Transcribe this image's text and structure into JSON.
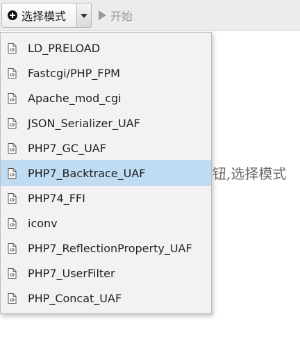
{
  "toolbar": {
    "mode_label": "选择模式",
    "start_label": "开始"
  },
  "background_text": "钮,选择模式",
  "menu": {
    "selected_index": 5,
    "items": [
      {
        "label": "LD_PRELOAD"
      },
      {
        "label": "Fastcgi/PHP_FPM"
      },
      {
        "label": "Apache_mod_cgi"
      },
      {
        "label": "JSON_Serializer_UAF"
      },
      {
        "label": "PHP7_GC_UAF"
      },
      {
        "label": "PHP7_Backtrace_UAF"
      },
      {
        "label": "PHP74_FFI"
      },
      {
        "label": "iconv"
      },
      {
        "label": "PHP7_ReflectionProperty_UAF"
      },
      {
        "label": "PHP7_UserFilter"
      },
      {
        "label": "PHP_Concat_UAF"
      }
    ]
  },
  "colors": {
    "selected_bg": "#bfdcf3",
    "menu_bg": "#f2f2f2",
    "toolbar_bg": "#ececec"
  }
}
